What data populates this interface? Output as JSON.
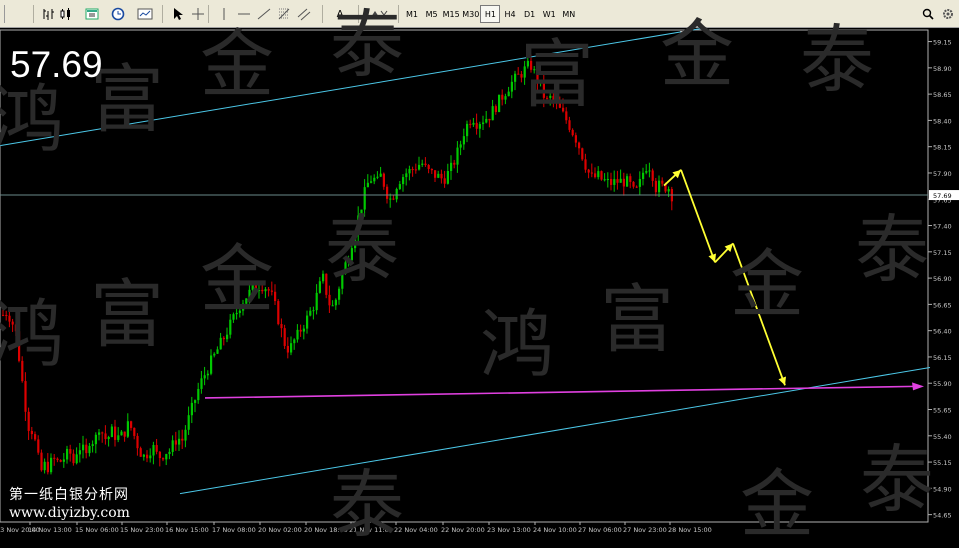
{
  "toolbar": {
    "timeframes": [
      {
        "label": "M1",
        "active": false
      },
      {
        "label": "M5",
        "active": false
      },
      {
        "label": "M15",
        "active": false
      },
      {
        "label": "M30",
        "active": false
      },
      {
        "label": "H1",
        "active": true
      },
      {
        "label": "H4",
        "active": false
      },
      {
        "label": "D1",
        "active": false
      },
      {
        "label": "W1",
        "active": false
      },
      {
        "label": "MN",
        "active": false
      }
    ],
    "text_tool_label": "A",
    "icons": [
      "bar-chart-icon",
      "candlestick-icon",
      "new-chart-icon",
      "clock-icon",
      "template-icon",
      "cursor-icon",
      "crosshair-icon",
      "vertical-line-icon",
      "horizontal-line-icon",
      "trendline-icon",
      "fibonacci-icon",
      "channel-icon",
      "text-icon",
      "arrows-icon",
      "search-icon",
      "settings-icon"
    ]
  },
  "overlay": {
    "current_price": "57.69",
    "site_name": "第一纸白银分析网",
    "site_url": "www.diyizby.com",
    "watermark_chars": [
      "鸿",
      "富",
      "金",
      "泰"
    ]
  },
  "chart_data": {
    "type": "candlestick",
    "symbol_price_label": "57.69",
    "timeframe": "H1",
    "y_axis_ticks": [
      "59.15",
      "58.90",
      "58.65",
      "58.40",
      "58.15",
      "57.90",
      "57.65",
      "57.40",
      "57.15",
      "56.90",
      "56.65",
      "56.40",
      "56.15",
      "55.90",
      "55.65",
      "55.40",
      "55.15",
      "54.90",
      "54.65"
    ],
    "x_axis_ticks": [
      "13 Nov 20:00",
      "14 Nov 13:00",
      "15 Nov 06:00",
      "15 Nov 23:00",
      "16 Nov 15:00",
      "17 Nov 08:00",
      "20 Nov 02:00",
      "20 Nov 18:00",
      "21 Nov 11:00",
      "22 Nov 04:00",
      "22 Nov 20:00",
      "23 Nov 13:00",
      "24 Nov 10:00",
      "27 Nov 06:00",
      "27 Nov 23:00",
      "28 Nov 15:00"
    ],
    "ylim": [
      54.58,
      59.26
    ],
    "current_price": 57.69,
    "colors": {
      "background": "#000000",
      "bull": "#00c800",
      "bear": "#dc0000",
      "channel": "#4cc8e8",
      "support": "#e040e0",
      "forecast": "#ffff33",
      "price_line": "#6a8a8a",
      "axis": "#b0b0b0"
    },
    "candle_count": 210,
    "closes": [
      56.55,
      56.58,
      56.5,
      56.4,
      56.1,
      55.8,
      55.5,
      55.45,
      55.3,
      55.05,
      55.12,
      55.1,
      55.18,
      55.15,
      55.16,
      55.2,
      55.25,
      55.14,
      55.3,
      55.28,
      55.2,
      55.4,
      55.32,
      55.5,
      55.42,
      55.35,
      55.45,
      55.4,
      55.38,
      55.42,
      55.5,
      55.47,
      55.35,
      55.25,
      55.2,
      55.25,
      55.3,
      55.22,
      55.2,
      55.25,
      55.25,
      55.32,
      55.39,
      55.34,
      55.48,
      55.6,
      55.72,
      55.84,
      55.94,
      56.02,
      56.1,
      56.17,
      56.25,
      56.32,
      56.4,
      56.48,
      56.56,
      56.64,
      56.7,
      56.75,
      56.78,
      56.82,
      56.84,
      56.82,
      56.78,
      56.7,
      56.55,
      56.4,
      56.25,
      56.22,
      56.3,
      56.36,
      56.44,
      56.5,
      56.58,
      56.66,
      56.8,
      56.9,
      56.74,
      56.6,
      56.68,
      56.84,
      56.98,
      57.1,
      57.25,
      57.4,
      57.55,
      57.7,
      57.82,
      57.86,
      57.8,
      57.88,
      57.76,
      57.64,
      57.7,
      57.82,
      57.86,
      57.9,
      57.92,
      57.95,
      57.98,
      57.99,
      57.92,
      57.9,
      57.88,
      57.86,
      57.84,
      57.89,
      57.95,
      58.05,
      58.16,
      58.3,
      58.38,
      58.44,
      58.38,
      58.4,
      58.42,
      58.44,
      58.5,
      58.56,
      58.62,
      58.68,
      58.74,
      58.78,
      58.82,
      58.86,
      58.9,
      58.93,
      58.84,
      58.75,
      58.65,
      58.58,
      58.62,
      58.56,
      58.5,
      58.44,
      58.38,
      58.3,
      58.22,
      58.12,
      58.0,
      57.9,
      57.84,
      57.88,
      57.84,
      57.82,
      57.8,
      57.81,
      57.82,
      57.82,
      57.82,
      57.78,
      57.7,
      57.76,
      57.9,
      57.98,
      57.96,
      57.76,
      57.78,
      57.76,
      57.78,
      57.69
    ],
    "annotations": {
      "channel_upper": {
        "from": {
          "x": 0,
          "price": 58.16
        },
        "to": {
          "x": 730,
          "price": 59.32
        }
      },
      "channel_lower": {
        "from": {
          "x": 180,
          "price": 54.85
        },
        "to": {
          "x": 930,
          "price": 56.05
        }
      },
      "support_arrow": {
        "from_price": 55.76,
        "to_price": 55.87
      },
      "forecast_path": [
        57.78,
        57.93,
        57.05,
        57.23,
        55.88
      ]
    }
  }
}
